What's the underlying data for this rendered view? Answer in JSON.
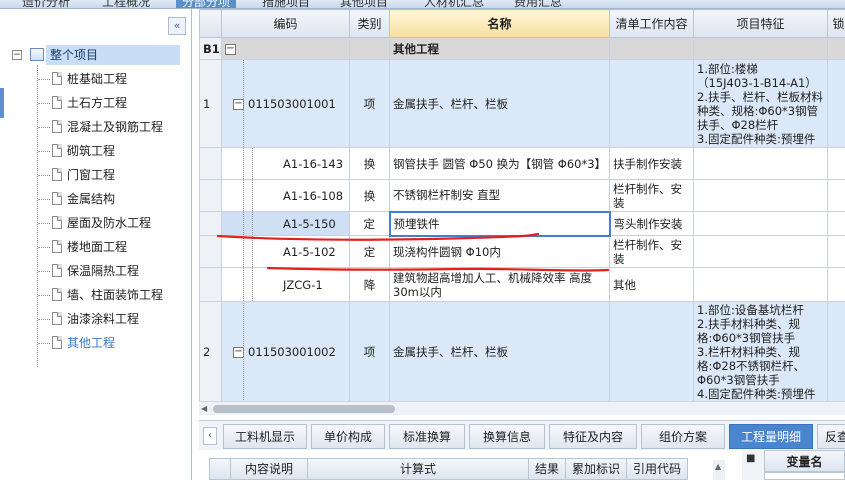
{
  "top_tabs": [
    "造价分析",
    "工程概况",
    "分部分项",
    "措施项目",
    "其他项目",
    "人材机汇总",
    "费用汇总"
  ],
  "top_tab_active_index": 2,
  "tree": {
    "collapse_glyph": "«",
    "root": "整个项目",
    "items": [
      "桩基础工程",
      "土石方工程",
      "混凝土及钢筋工程",
      "砌筑工程",
      "门窗工程",
      "金属结构",
      "屋面及防水工程",
      "楼地面工程",
      "保温隔热工程",
      "墙、柱面装饰工程",
      "油漆涂料工程",
      "其他工程"
    ],
    "selected": "其他工程"
  },
  "grid": {
    "headers": [
      "",
      "编码",
      "类别",
      "名称",
      "清单工作内容",
      "项目特征",
      "锁"
    ],
    "rows": [
      {
        "num": "B1",
        "code": "",
        "type": "",
        "name": "其他工程",
        "work": "",
        "feature": ""
      },
      {
        "num": "1",
        "code": "011503001001",
        "type": "项",
        "name": "金属扶手、栏杆、栏板",
        "work": "",
        "feature": "1.部位:楼梯\n（15J403-1-B14-A1）\n2.扶手、栏杆、栏板材料种类、规格:Φ60*3钢管扶手、Φ28栏杆\n3.固定配件种类:预埋件"
      },
      {
        "num": "",
        "code": "A1-16-143",
        "type": "换",
        "name": "钢管扶手 圆管 Φ50  换为【钢管 Φ60*3】",
        "work": "扶手制作安装",
        "feature": ""
      },
      {
        "num": "",
        "code": "A1-16-108",
        "type": "换",
        "name": "不锈钢栏杆制安 直型",
        "work": "栏杆制作、安装",
        "feature": ""
      },
      {
        "num": "",
        "code": "A1-5-150",
        "type": "定",
        "name": "预埋铁件",
        "work": "弯头制作安装",
        "feature": ""
      },
      {
        "num": "",
        "code": "A1-5-102",
        "type": "定",
        "name": "现浇构件圆钢 Φ10内",
        "work": "栏杆制作、安装",
        "feature": ""
      },
      {
        "num": "",
        "code": "JZCG-1",
        "type": "降",
        "name": "建筑物超高增加人工、机械降效率 高度30m以内",
        "work": "其他",
        "feature": ""
      },
      {
        "num": "2",
        "code": "011503001002",
        "type": "项",
        "name": "金属扶手、栏杆、栏板",
        "work": "",
        "feature": "1.部位:设备基坑栏杆\n2.扶手材料种类、规格:Φ60*3钢管扶手\n3.栏杆材料种类、规格:Φ28不锈钢栏杆、Φ60*3钢管扶手\n4.固定配件种类:预埋件"
      }
    ]
  },
  "bottom_tabs": [
    "工料机显示",
    "单价构成",
    "标准换算",
    "换算信息",
    "特征及内容",
    "组价方案",
    "工程量明细",
    "反查"
  ],
  "bottom_tab_nav": "‹",
  "bottom_tab_active_index": 6,
  "detail_headers": [
    "内容说明",
    "计算式",
    "结果",
    "累加标识",
    "引用代码"
  ],
  "var_panel_header": "变量名",
  "var_panel_marker": "■",
  "colors": {
    "accent": "#4a86d0",
    "ink": "#e3201c",
    "selected_row": "#cfe0f5"
  }
}
